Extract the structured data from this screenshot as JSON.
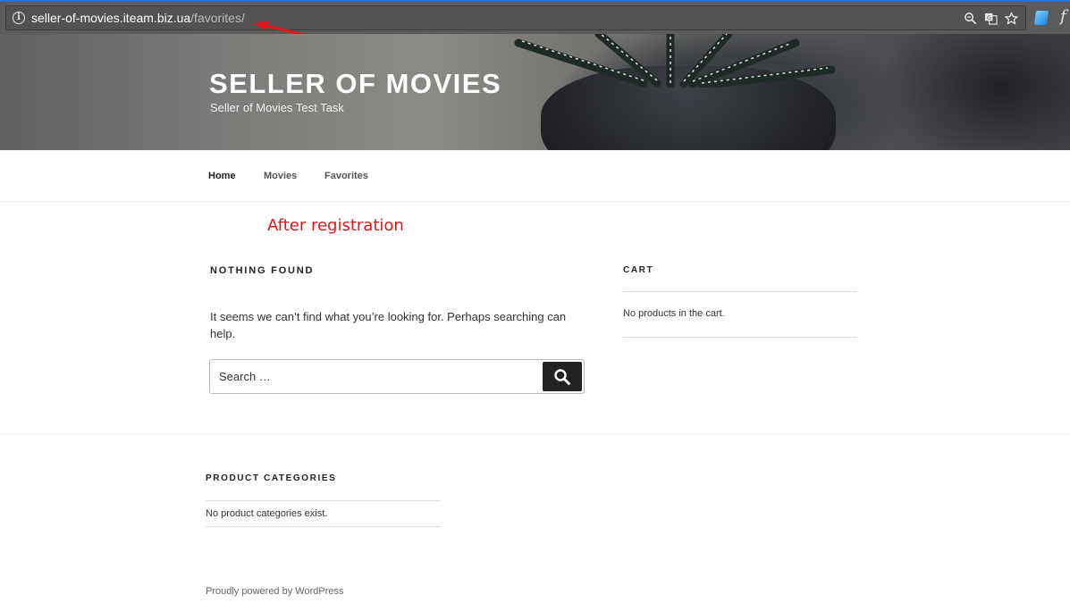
{
  "browser": {
    "url_host": "seller-of-movies.iteam.biz.ua",
    "url_path": "/favorites/",
    "icons": [
      "info-icon",
      "zoom-icon",
      "translate-icon",
      "star-icon",
      "extension-icon"
    ]
  },
  "header": {
    "site_title": "SELLER OF MOVIES",
    "site_description": "Seller of Movies Test Task"
  },
  "nav": {
    "items": [
      {
        "label": "Home",
        "current": true
      },
      {
        "label": "Movies",
        "current": false
      },
      {
        "label": "Favorites",
        "current": false
      }
    ]
  },
  "annotation": {
    "text": "After registration",
    "color": "#e0171a"
  },
  "main": {
    "title": "NOTHING FOUND",
    "message": "It seems we can’t find what you’re looking for. Perhaps searching can help.",
    "search": {
      "placeholder": "Search …",
      "button_icon": "search-icon"
    }
  },
  "sidebar": {
    "cart": {
      "title": "CART",
      "empty_text": "No products in the cart."
    }
  },
  "footer": {
    "product_categories": {
      "title": "PRODUCT CATEGORIES",
      "empty_text": "No product categories exist."
    },
    "powered_by": "Proudly powered by WordPress"
  }
}
